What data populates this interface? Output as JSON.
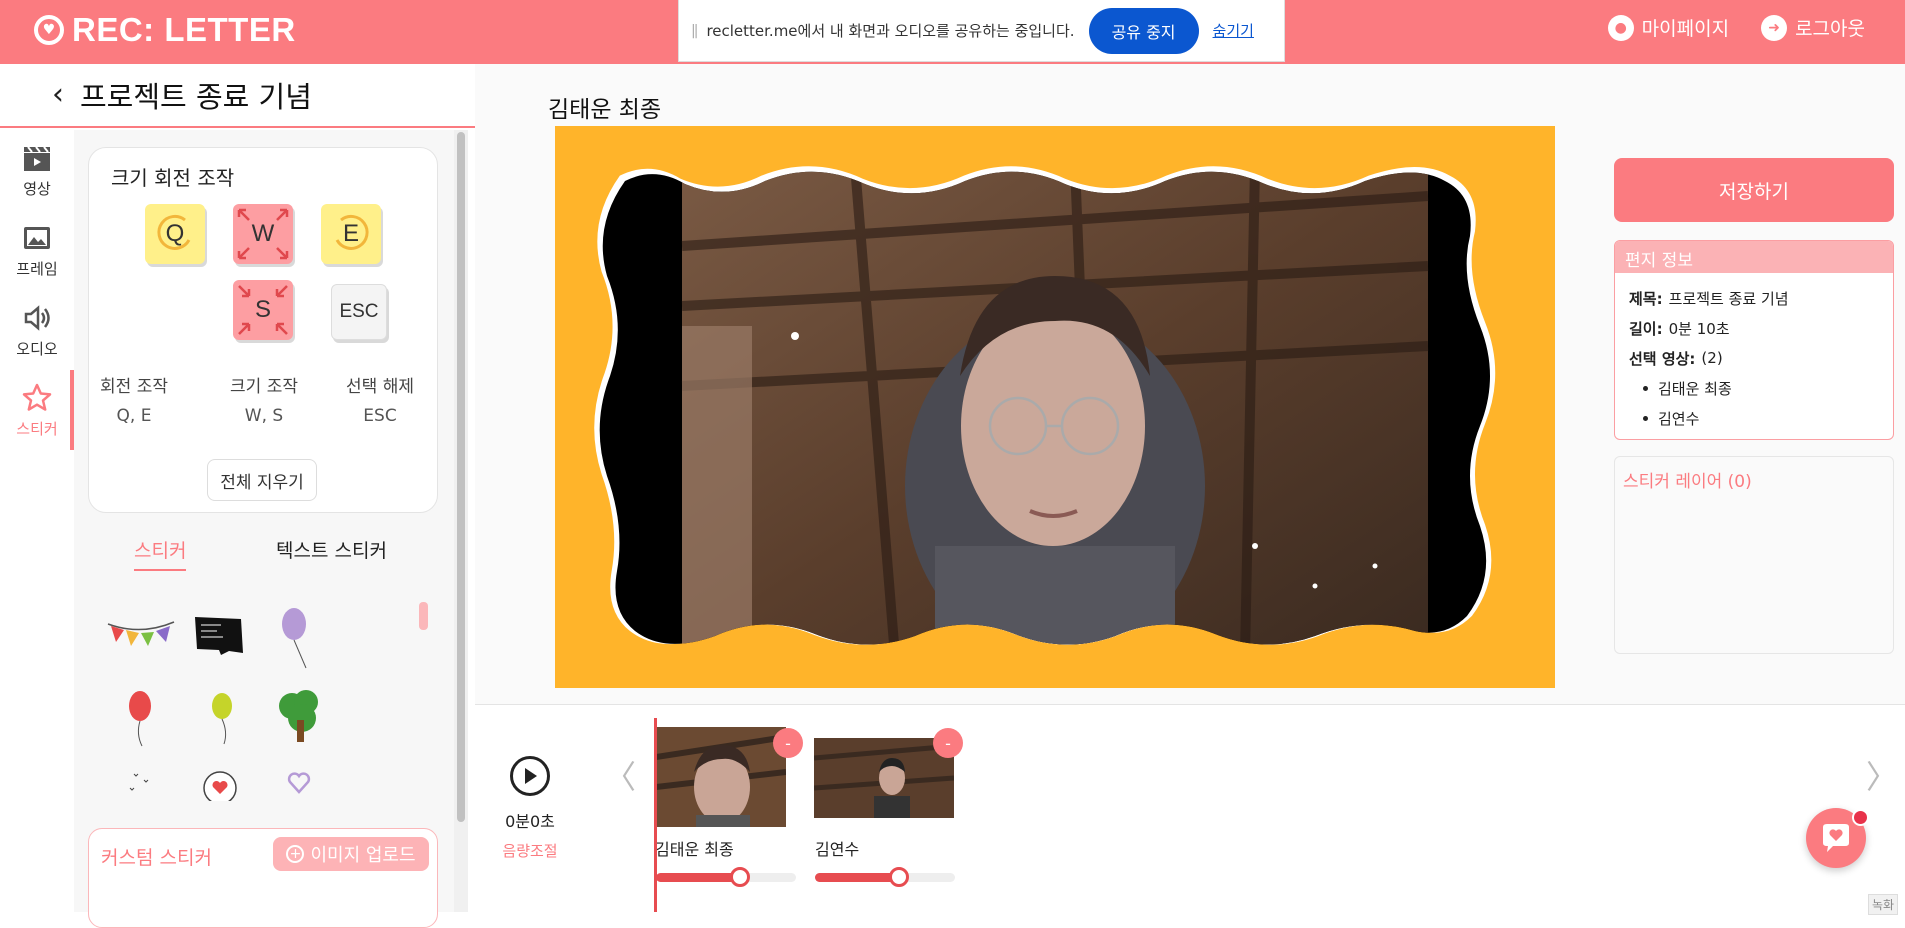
{
  "header": {
    "logo_text": "REC: LETTER",
    "mypage_label": "마이페이지",
    "logout_label": "로그아웃",
    "share_message": "recletter.me에서 내 화면과 오디오를 공유하는 중입니다.",
    "share_stop_label": "공유 중지",
    "share_hide_label": "숨기기"
  },
  "left": {
    "project_title": "프로젝트 종료 기념",
    "rail": [
      {
        "label": "영상",
        "icon": "clapperboard-icon"
      },
      {
        "label": "프레임",
        "icon": "image-icon"
      },
      {
        "label": "오디오",
        "icon": "speaker-icon"
      },
      {
        "label": "스티커",
        "icon": "star-icon"
      }
    ],
    "controls": {
      "title": "크기 회전 조작",
      "keys": [
        "Q",
        "W",
        "E",
        "S",
        "ESC"
      ],
      "groups": [
        {
          "label": "회전 조작",
          "value": "Q, E"
        },
        {
          "label": "크기 조작",
          "value": "W, S"
        },
        {
          "label": "선택 해제",
          "value": "ESC"
        }
      ],
      "clear_label": "전체 지우기"
    },
    "tabs": {
      "sticker": "스티커",
      "text_sticker": "텍스트 스티커"
    },
    "custom": {
      "title": "커스텀 스티커",
      "upload_label": "이미지 업로드"
    }
  },
  "center": {
    "video_title": "김태운 최종",
    "frame_color": "#ffb42a"
  },
  "right": {
    "save_label": "저장하기",
    "info": {
      "title": "편지 정보",
      "subject_label": "제목:",
      "subject_value": "프로젝트 종료 기념",
      "length_label": "길이:",
      "length_value": "0분 10초",
      "selected_label": "선택 영상:",
      "selected_value": "(2)",
      "items": [
        "김태운 최종",
        "김연수"
      ]
    },
    "layer_title": "스티커 레이어 (0)"
  },
  "timeline": {
    "time": "0분0초",
    "volume_label": "음량조절",
    "clips": [
      {
        "name": "김태운 최종",
        "volume": 0.6
      },
      {
        "name": "김연수",
        "volume": 0.6
      }
    ]
  },
  "footer": {
    "corner_note": "녹화"
  },
  "colors": {
    "brand": "#fb7b80",
    "share_blue": "#0b57d0"
  }
}
